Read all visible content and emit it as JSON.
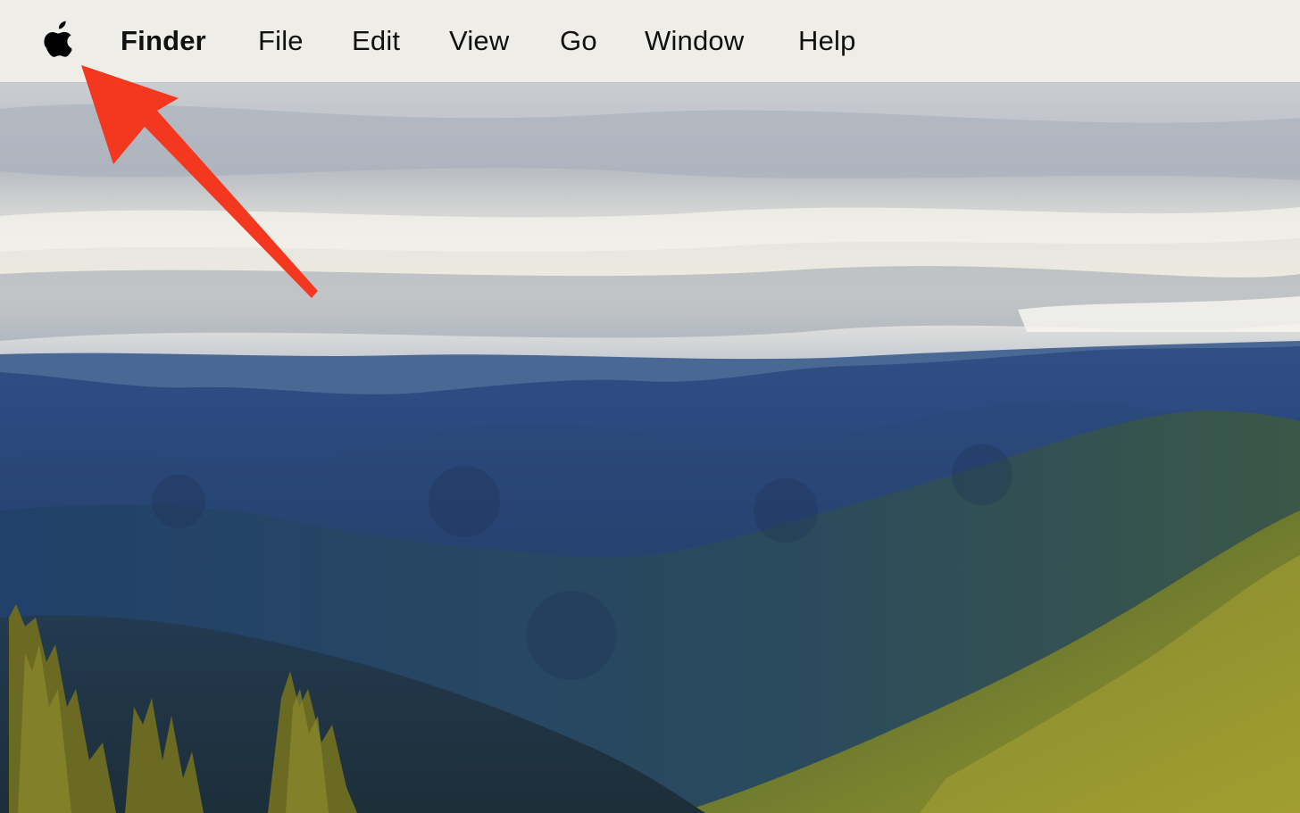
{
  "menubar": {
    "apple_icon": "apple-logo-icon",
    "app_name": "Finder",
    "items": [
      {
        "label": "File"
      },
      {
        "label": "Edit"
      },
      {
        "label": "View"
      },
      {
        "label": "Go"
      },
      {
        "label": "Window"
      },
      {
        "label": "Help"
      }
    ],
    "background_color": "#efede8"
  },
  "annotation": {
    "type": "arrow",
    "color": "#f4381f",
    "points_to": "apple-menu"
  },
  "wallpaper": {
    "subject": "forested mountain landscape"
  }
}
